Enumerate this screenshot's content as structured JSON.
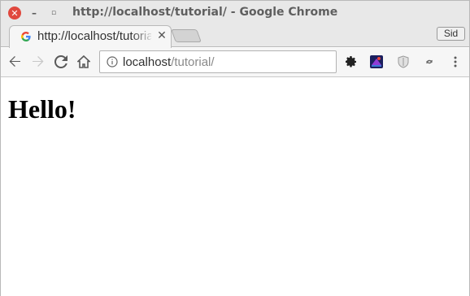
{
  "window": {
    "title": "http://localhost/tutorial/ - Google Chrome",
    "close_glyph": "✕",
    "minimize_glyph": "–",
    "maximize_glyph": "▫",
    "close_color": "#e0483e"
  },
  "tab": {
    "title": "http://localhost/tutorial/",
    "close_glyph": "✕",
    "favicon": "google-g-icon"
  },
  "profile": {
    "label": "Sid"
  },
  "toolbar": {
    "omnibox": {
      "host": "localhost",
      "path": "/tutorial/",
      "info_icon": "info-icon"
    },
    "icons": [
      "back-arrow-icon",
      "forward-arrow-icon",
      "reload-icon",
      "home-icon",
      "gear-icon",
      "extension-icon",
      "shield-icon",
      "extension-small-icon",
      "kebab-menu-icon"
    ]
  },
  "content": {
    "heading": "Hello!"
  }
}
